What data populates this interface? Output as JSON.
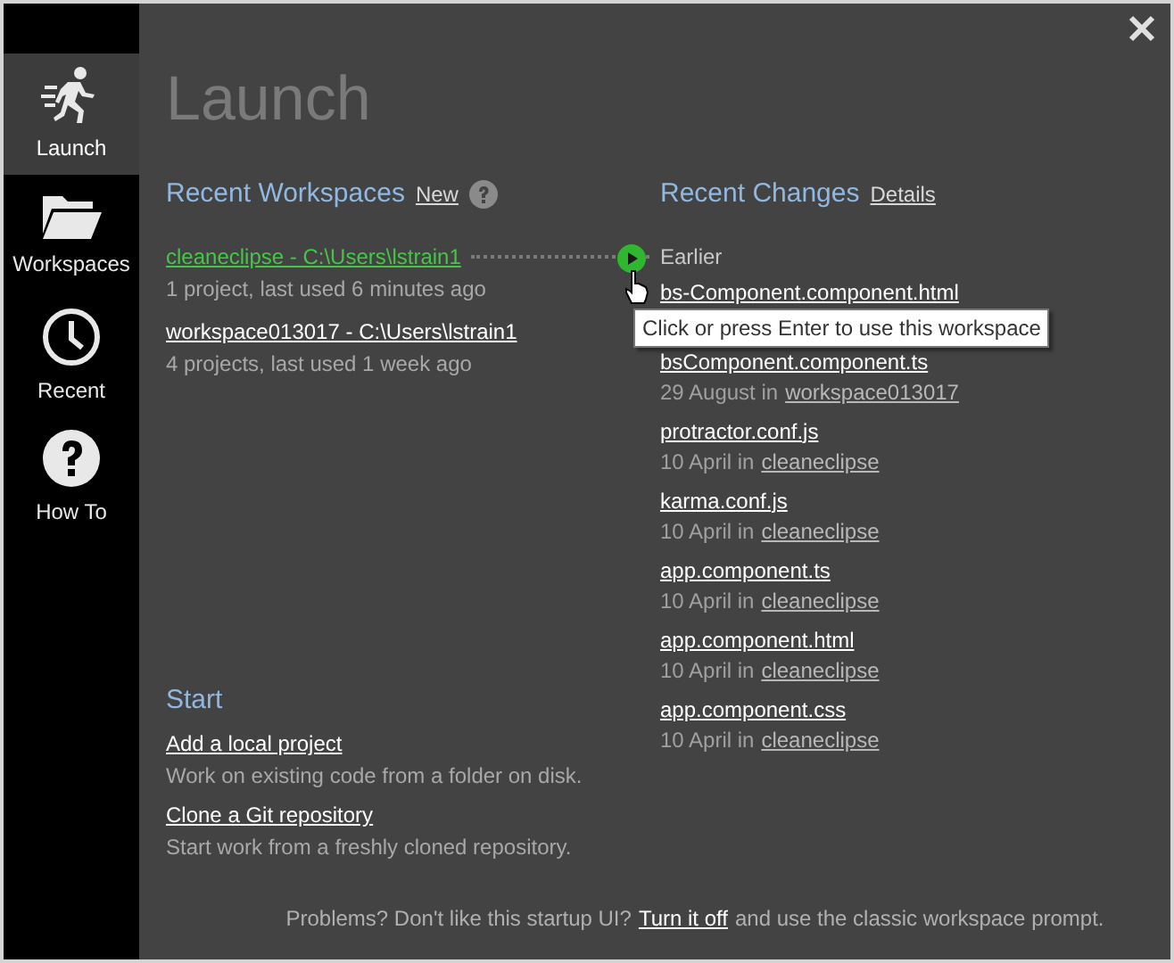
{
  "sidebar": {
    "items": [
      {
        "label": "Launch",
        "kind": "launch",
        "selected": true
      },
      {
        "label": "Workspaces",
        "kind": "workspaces",
        "selected": false
      },
      {
        "label": "Recent",
        "kind": "recent",
        "selected": false
      },
      {
        "label": "How To",
        "kind": "howto",
        "selected": false
      }
    ]
  },
  "title": "Launch",
  "recent_workspaces": {
    "heading": "Recent Workspaces",
    "new_link": "New",
    "items": [
      {
        "name": "cleaneclipse - C:\\Users\\lstrain1",
        "detail": "1 project, last used 6 minutes ago",
        "selected": true
      },
      {
        "name": "workspace013017 - C:\\Users\\lstrain1",
        "detail": "4 projects, last used 1 week ago",
        "selected": false
      }
    ],
    "tooltip": "Click or press Enter to use this workspace"
  },
  "recent_changes": {
    "heading": "Recent Changes",
    "details_link": "Details",
    "group": "Earlier",
    "items": [
      {
        "file": "bs-Component.component.html"
      },
      {
        "file": "bsComponent.component.ts",
        "date": "29 August in",
        "workspace": "workspace013017"
      },
      {
        "file": "protractor.conf.js",
        "date": "10 April in",
        "workspace": "cleaneclipse"
      },
      {
        "file": "karma.conf.js",
        "date": "10 April in",
        "workspace": "cleaneclipse"
      },
      {
        "file": "app.component.ts",
        "date": "10 April in",
        "workspace": "cleaneclipse"
      },
      {
        "file": "app.component.html",
        "date": "10 April in",
        "workspace": "cleaneclipse"
      },
      {
        "file": "app.component.css",
        "date": "10 April in",
        "workspace": "cleaneclipse"
      }
    ]
  },
  "start": {
    "heading": "Start",
    "items": [
      {
        "link": "Add a local project",
        "description": "Work on existing code from a folder on disk."
      },
      {
        "link": "Clone a Git repository",
        "description": "Start work from a freshly cloned repository."
      }
    ]
  },
  "footer": {
    "before": "Problems? Don't like this startup UI?",
    "link": "Turn it off",
    "after": "and use the classic workspace prompt."
  }
}
